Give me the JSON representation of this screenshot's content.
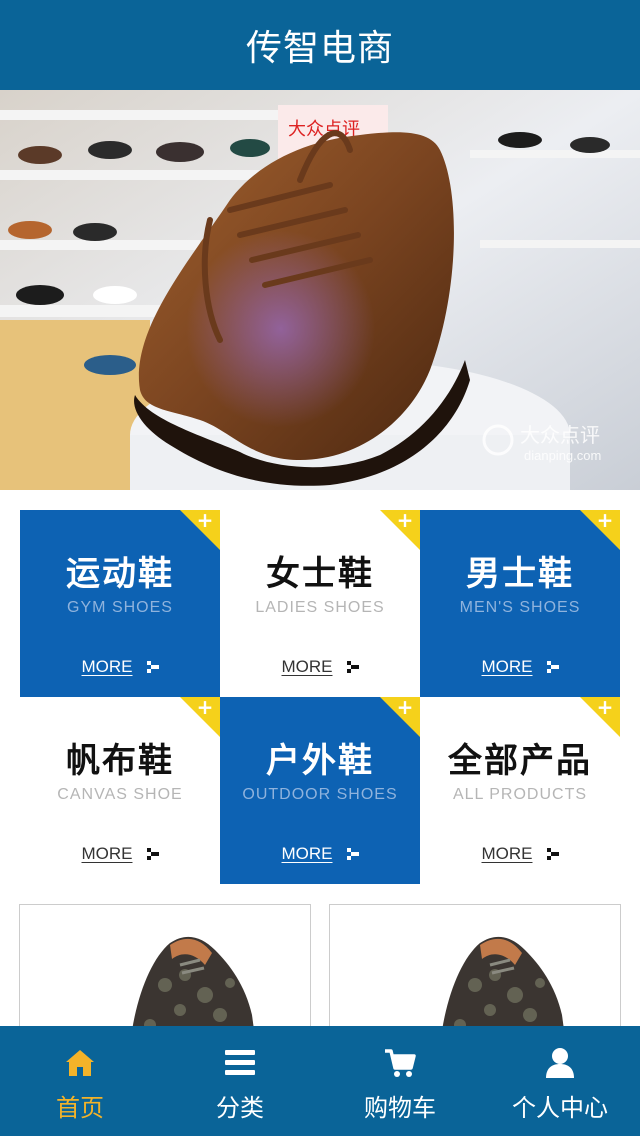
{
  "header": {
    "title": "传智电商"
  },
  "banner": {
    "watermark_cn": "大众点评",
    "watermark_en": "dianping.com"
  },
  "categories": [
    {
      "cn": "运动鞋",
      "en": "GYM SHOES",
      "more": "MORE",
      "style": "blue"
    },
    {
      "cn": "女士鞋",
      "en": "LADIES SHOES",
      "more": "MORE",
      "style": "white"
    },
    {
      "cn": "男士鞋",
      "en": "MEN'S SHOES",
      "more": "MORE",
      "style": "blue"
    },
    {
      "cn": "帆布鞋",
      "en": "CANVAS SHOE",
      "more": "MORE",
      "style": "white"
    },
    {
      "cn": "户外鞋",
      "en": "OUTDOOR SHOES",
      "more": "MORE",
      "style": "blue"
    },
    {
      "cn": "全部产品",
      "en": "ALL PRODUCTS",
      "more": "MORE",
      "style": "white"
    }
  ],
  "tabbar": {
    "items": [
      {
        "label": "首页",
        "icon": "home-icon",
        "active": true
      },
      {
        "label": "分类",
        "icon": "menu-icon",
        "active": false
      },
      {
        "label": "购物车",
        "icon": "cart-icon",
        "active": false
      },
      {
        "label": "个人中心",
        "icon": "user-icon",
        "active": false
      }
    ]
  },
  "colors": {
    "primary": "#0a6498",
    "tile_blue": "#0d62b3",
    "corner_yellow": "#f5d11b",
    "active_tab": "#f3b329"
  }
}
